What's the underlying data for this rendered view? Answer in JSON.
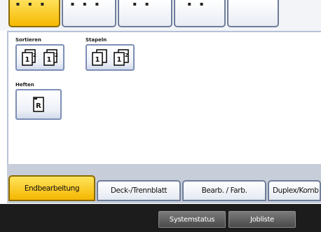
{
  "groups": {
    "sort": {
      "label": "Sortieren",
      "icons": [
        "sort-icon",
        "rotate-sort-icon"
      ]
    },
    "stack": {
      "label": "Stapeln",
      "icons": [
        "stack-icon",
        "shift-stack-icon"
      ]
    },
    "staple": {
      "label": "Heften",
      "icons": [
        "staple-icon"
      ]
    }
  },
  "tabs": [
    {
      "label": "Endbearbeitung",
      "active": true
    },
    {
      "label": "Deck-/Trennblatt",
      "active": false
    },
    {
      "label": "Bearb. / Farb.",
      "active": false
    },
    {
      "label": "Duplex/Komb",
      "active": false
    }
  ],
  "status_bar": {
    "system_status_label": "Systemstatus",
    "job_list_label": "Jobliste"
  },
  "colors": {
    "active_tab": "#f5b600",
    "button_border": "#7d8fb6",
    "status_bar": "#1c1c1c"
  }
}
